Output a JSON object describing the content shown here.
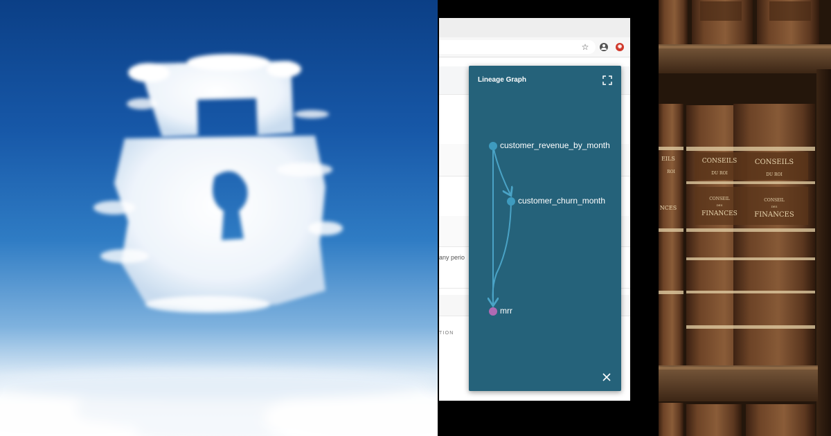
{
  "colors": {
    "modal_bg": "#25627a",
    "node_source": "#3e9bbf",
    "node_target": "#b06ab3",
    "edge": "#4aa3c6",
    "sky_top": "#0b3f86",
    "leather": "#6b3f22"
  },
  "browser": {
    "toolbar_icons": [
      "star-icon",
      "account-icon",
      "extension-icon"
    ],
    "background_fragments": {
      "period_text": "any perio",
      "option_caption": "TION"
    }
  },
  "lineage_graph": {
    "title": "Lineage Graph",
    "icons": [
      "expand-icon",
      "close-icon"
    ],
    "nodes": [
      {
        "id": "customer_revenue_by_month",
        "label": "customer_revenue_by_month",
        "kind": "source"
      },
      {
        "id": "customer_churn_month",
        "label": "customer_churn_month",
        "kind": "source"
      },
      {
        "id": "mrr",
        "label": "mrr",
        "kind": "target"
      }
    ],
    "edges": [
      {
        "from": "customer_revenue_by_month",
        "to": "customer_churn_month"
      },
      {
        "from": "customer_revenue_by_month",
        "to": "mrr"
      },
      {
        "from": "customer_churn_month",
        "to": "mrr"
      }
    ]
  },
  "books": {
    "spine_texts": [
      {
        "line1": "CONSEILS",
        "line2": "DU ROI",
        "line3": "CONSEIL",
        "line4": "DES",
        "line5": "FINANCES"
      },
      {
        "line1": "CONSEILS",
        "line2": "DU ROI",
        "line3": "CONSEIL",
        "line4": "DES",
        "line5": "FINANCES"
      }
    ],
    "partial_spine_texts": [
      "EILS",
      "ROI",
      "NCES"
    ]
  }
}
